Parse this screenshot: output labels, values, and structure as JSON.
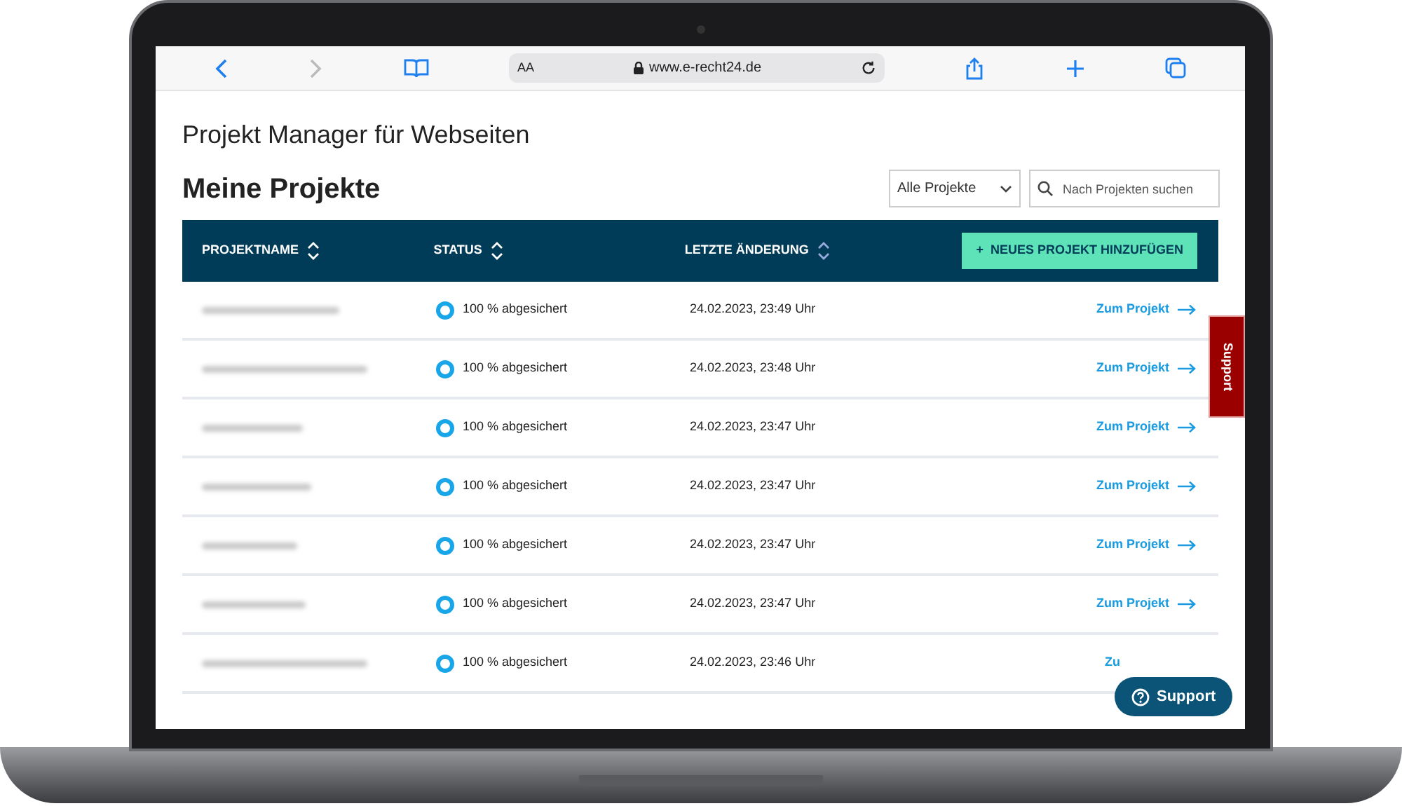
{
  "browser": {
    "text_size": "AA",
    "url": "www.e-recht24.de"
  },
  "page_title": "Projekt Manager für Webseiten",
  "section_title": "Meine Projekte",
  "filter": {
    "value": "Alle Projekte"
  },
  "search": {
    "placeholder": "Nach Projekten suchen"
  },
  "table": {
    "columns": [
      "PROJEKTNAME",
      "STATUS",
      "LETZTE ÄNDERUNG"
    ],
    "add_button": "+  NEUES PROJEKT HINZUFÜGEN",
    "rows": [
      {
        "status": "100 % abgesichert",
        "changed": "24.02.2023, 23:49 Uhr",
        "link": "Zum Projekt"
      },
      {
        "status": "100 % abgesichert",
        "changed": "24.02.2023, 23:48 Uhr",
        "link": "Zum Projekt"
      },
      {
        "status": "100 % abgesichert",
        "changed": "24.02.2023, 23:47 Uhr",
        "link": "Zum Projekt"
      },
      {
        "status": "100 % abgesichert",
        "changed": "24.02.2023, 23:47 Uhr",
        "link": "Zum Projekt"
      },
      {
        "status": "100 % abgesichert",
        "changed": "24.02.2023, 23:47 Uhr",
        "link": "Zum Projekt"
      },
      {
        "status": "100 % abgesichert",
        "changed": "24.02.2023, 23:47 Uhr",
        "link": "Zum Projekt"
      },
      {
        "status": "100 % abgesichert",
        "changed": "24.02.2023, 23:46 Uhr",
        "link": "Zu"
      }
    ]
  },
  "support_tab": "Support",
  "support_button": "Support"
}
